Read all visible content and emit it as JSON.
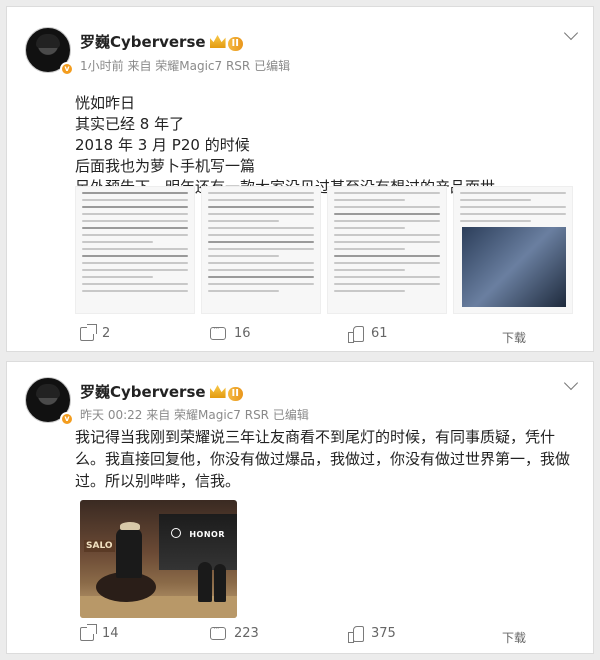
{
  "posts": [
    {
      "username": "罗巍Cyberverse",
      "level_badge": "II",
      "verified_badge": "v",
      "meta": "1小时前 来自 荣耀Magic7 RSR 已编辑",
      "lines": [
        "恍如昨日",
        "其实已经 8 年了",
        "2018 年 3 月 P20 的时候",
        "后面我也为萝卜手机写一篇",
        "另外预告下，明年还有一款大家没见过甚至没有想过的产品面世"
      ],
      "images_count": 4,
      "actions": {
        "share": "2",
        "comment": "16",
        "like": "61",
        "download": "下载"
      }
    },
    {
      "username": "罗巍Cyberverse",
      "level_badge": "II",
      "verified_badge": "v",
      "meta": "昨天 00:22 来自 荣耀Magic7 RSR 已编辑",
      "text": "我记得当我刚到荣耀说三年让友商看不到尾灯的时候，有同事质疑，凭什么。我直接回复他，你没有做过爆品，我做过，你没有做过世界第一，我做过。所以别哔哔，信我。",
      "photo_labels": {
        "brand": "HONOR",
        "sign": "SALO"
      },
      "actions": {
        "share": "14",
        "comment": "223",
        "like": "375",
        "download": "下载"
      }
    }
  ],
  "colors": {
    "meta": "#8a8a8a",
    "badge": "#f39d1f",
    "text": "#222222"
  }
}
